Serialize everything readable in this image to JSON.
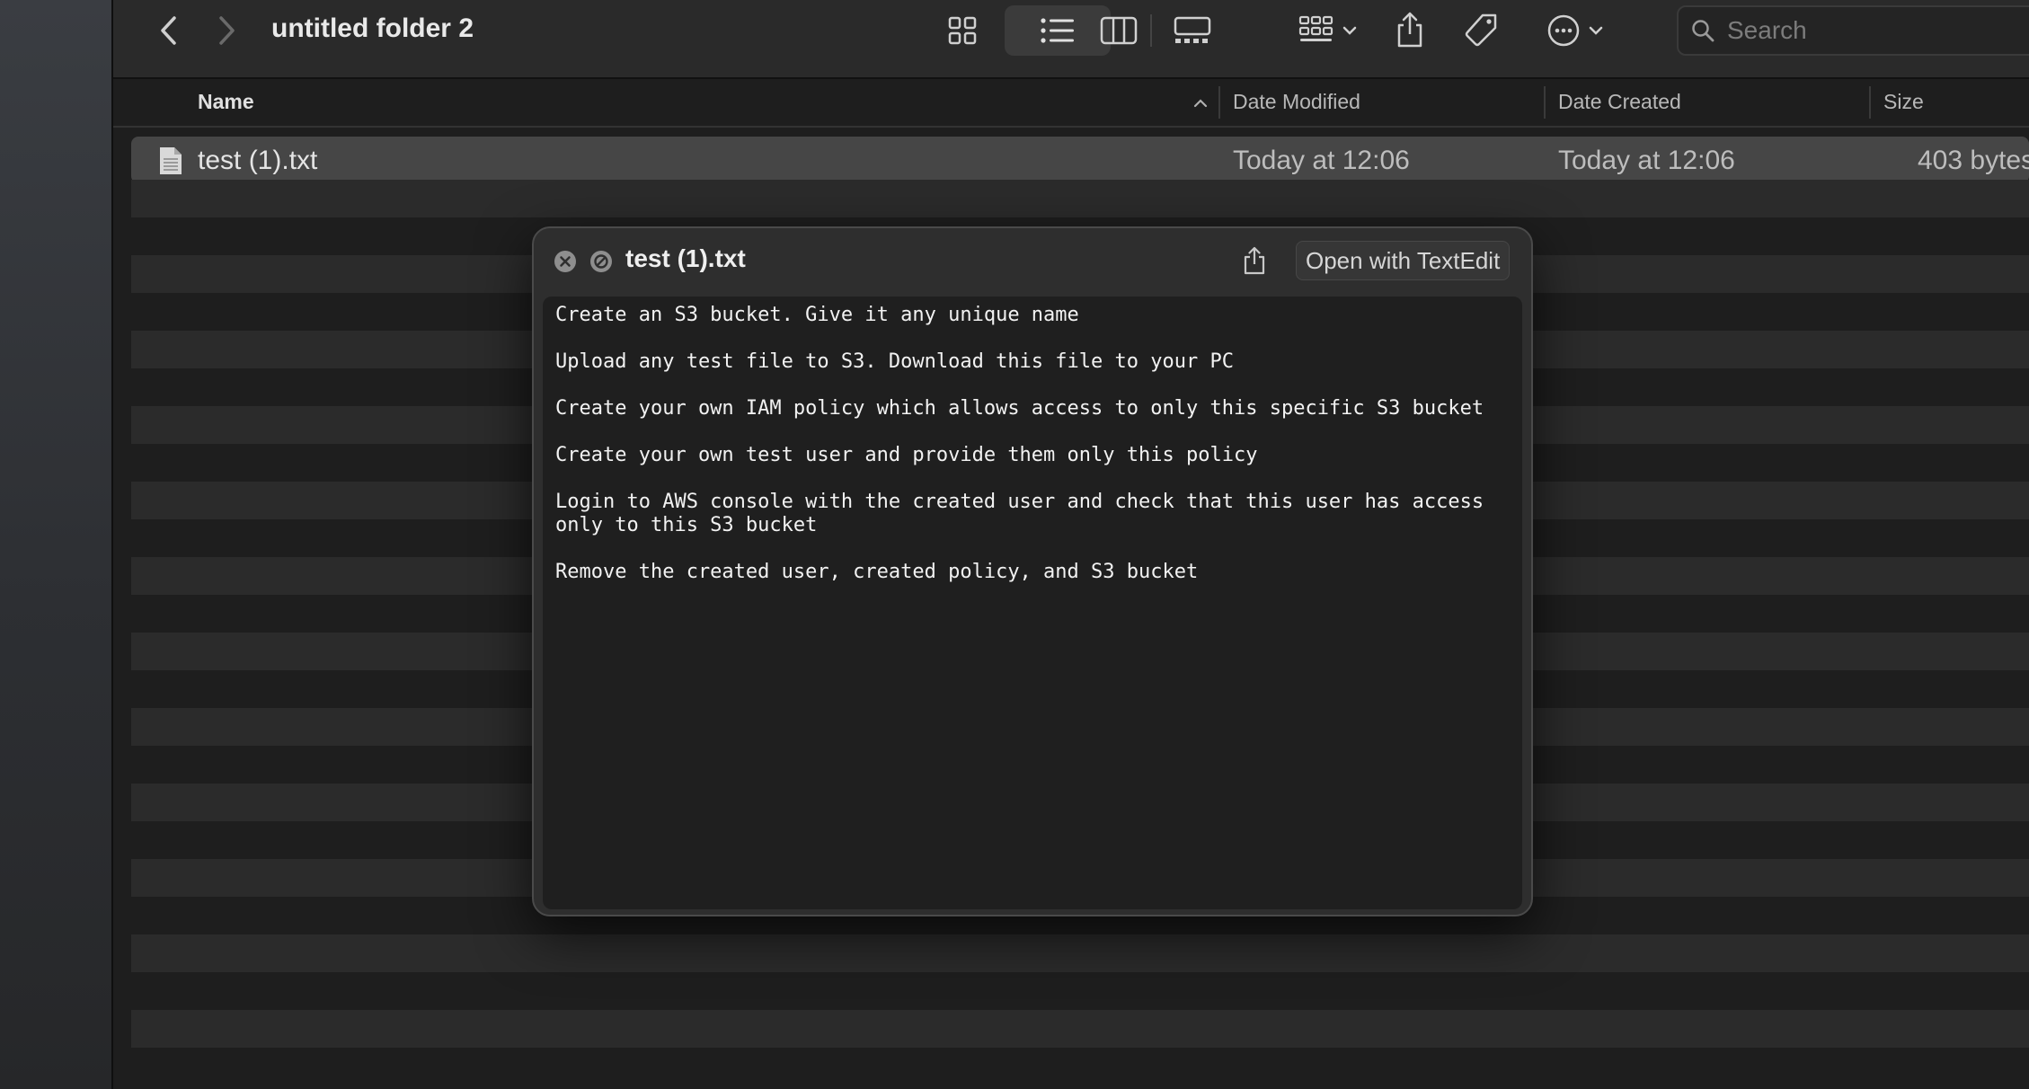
{
  "window": {
    "folder_title": "untitled folder 2"
  },
  "search": {
    "placeholder": "Search"
  },
  "columns": {
    "name": "Name",
    "date_modified": "Date Modified",
    "date_created": "Date Created",
    "size": "Size"
  },
  "files": [
    {
      "name": "test (1).txt",
      "date_modified": "Today at 12:06",
      "date_created": "Today at 12:06",
      "size": "403 bytes"
    }
  ],
  "quicklook": {
    "title": "test (1).txt",
    "open_button": "Open with TextEdit",
    "lines": [
      "Create an S3 bucket. Give it any unique name",
      "Upload any test file to S3. Download this file to your PC",
      "Create your own IAM policy which allows access to only this specific S3 bucket",
      "Create your own test user and provide them only this policy",
      "Login to AWS console with the created user and check that this user has access",
      "only to this S3 bucket",
      "Remove the created user, created policy, and S3 bucket"
    ]
  },
  "icons": {
    "back": "chevron-left-icon",
    "forward": "chevron-right-icon",
    "view_icons": "grid-icon",
    "view_list": "list-icon",
    "view_columns": "columns-icon",
    "view_gallery": "gallery-icon",
    "group": "group-icon",
    "share": "share-icon",
    "tag": "tag-icon",
    "more": "ellipsis-circle-icon",
    "search": "magnifier-icon",
    "file": "document-icon",
    "close": "close-circle-icon",
    "block": "block-circle-icon"
  },
  "colors": {
    "background": "#1e1e1e",
    "toolbar": "#2a2a2a",
    "selected_row": "#464646",
    "stripe": "#2b2b2b"
  }
}
